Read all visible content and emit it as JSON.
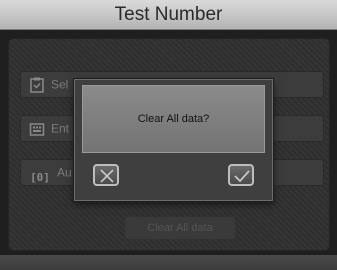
{
  "header": {
    "title": "Test Number"
  },
  "menu": {
    "items": [
      {
        "label": "Sel",
        "icon": "clipboard-icon"
      },
      {
        "label": "Ent",
        "icon": "keypad-icon"
      },
      {
        "label": "Au",
        "icon": "zero-code-icon",
        "code": "[0]"
      }
    ],
    "clear_all_label": "Clear All data"
  },
  "dialog": {
    "message": "Clear All data?",
    "cancel_icon": "close-icon",
    "confirm_icon": "check-icon"
  },
  "colors": {
    "background": "#1f1f1f",
    "title_bar": "#c8c8c8",
    "dialog": "#3f3f3f"
  }
}
